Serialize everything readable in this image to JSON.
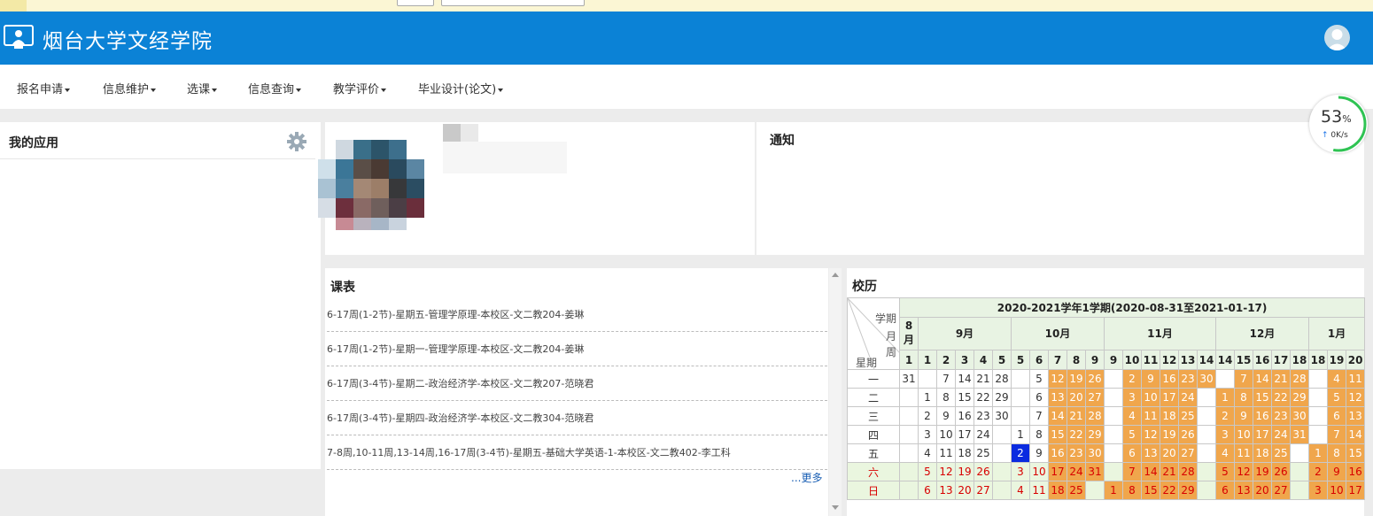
{
  "header": {
    "title": "烟台大学文经学院"
  },
  "nav": [
    "报名申请",
    "信息维护",
    "选课",
    "信息查询",
    "教学评价",
    "毕业设计(论文)"
  ],
  "apps": {
    "title": "我的应用"
  },
  "notice": {
    "title": "通知"
  },
  "schedule": {
    "title": "课表",
    "rows": [
      "6-17周(1-2节)-星期五-管理学原理-本校区-文二教204-姜琳",
      "6-17周(1-2节)-星期一-管理学原理-本校区-文二教204-姜琳",
      "6-17周(3-4节)-星期二-政治经济学-本校区-文二教207-范晓君",
      "6-17周(3-4节)-星期四-政治经济学-本校区-文二教304-范晓君",
      "7-8周,10-11周,13-14周,16-17周(3-4节)-星期五-基础大学英语-1-本校区-文二教402-李工科"
    ],
    "more": "...更多"
  },
  "calendar": {
    "title": "校历",
    "semester": "2020-2021学年1学期(2020-08-31至2021-01-17)",
    "corner": {
      "term": "学期",
      "month": "月",
      "week": "周",
      "weekday": "星期"
    },
    "months": [
      {
        "label": "8月",
        "span": 1
      },
      {
        "label": "9月",
        "span": 5
      },
      {
        "label": "10月",
        "span": 5
      },
      {
        "label": "11月",
        "span": 6
      },
      {
        "label": "12月",
        "span": 5
      },
      {
        "label": "1月",
        "span": 3
      }
    ],
    "weeks": [
      "1",
      "1",
      "2",
      "3",
      "4",
      "5",
      "5",
      "6",
      "7",
      "8",
      "9",
      "9",
      "10",
      "11",
      "12",
      "13",
      "14",
      "14",
      "15",
      "16",
      "17",
      "18",
      "18",
      "19",
      "20"
    ],
    "days": [
      {
        "name": "一",
        "cells": [
          "31",
          "",
          "7",
          "14",
          "21",
          "28",
          "",
          "5",
          "12",
          "19",
          "26",
          "",
          "2",
          "9",
          "16",
          "23",
          "30",
          "",
          "7",
          "14",
          "21",
          "28",
          "",
          "4",
          "11"
        ]
      },
      {
        "name": "二",
        "cells": [
          "",
          "1",
          "8",
          "15",
          "22",
          "29",
          "",
          "6",
          "13",
          "20",
          "27",
          "",
          "3",
          "10",
          "17",
          "24",
          "",
          "1",
          "8",
          "15",
          "22",
          "29",
          "",
          "5",
          "12"
        ]
      },
      {
        "name": "三",
        "cells": [
          "",
          "2",
          "9",
          "16",
          "23",
          "30",
          "",
          "7",
          "14",
          "21",
          "28",
          "",
          "4",
          "11",
          "18",
          "25",
          "",
          "2",
          "9",
          "16",
          "23",
          "30",
          "",
          "6",
          "13"
        ]
      },
      {
        "name": "四",
        "cells": [
          "",
          "3",
          "10",
          "17",
          "24",
          "",
          "1",
          "8",
          "15",
          "22",
          "29",
          "",
          "5",
          "12",
          "19",
          "26",
          "",
          "3",
          "10",
          "17",
          "24",
          "31",
          "",
          "7",
          "14"
        ]
      },
      {
        "name": "五",
        "cells": [
          "",
          "4",
          "11",
          "18",
          "25",
          "",
          "2",
          "9",
          "16",
          "23",
          "30",
          "",
          "6",
          "13",
          "20",
          "27",
          "",
          "4",
          "11",
          "18",
          "25",
          "",
          "1",
          "8",
          "15"
        ]
      },
      {
        "name": "六",
        "cells": [
          "",
          "5",
          "12",
          "19",
          "26",
          "",
          "3",
          "10",
          "17",
          "24",
          "31",
          "",
          "7",
          "14",
          "21",
          "28",
          "",
          "5",
          "12",
          "19",
          "26",
          "",
          "2",
          "9",
          "16"
        ]
      },
      {
        "name": "日",
        "cells": [
          "",
          "6",
          "13",
          "20",
          "27",
          "",
          "4",
          "11",
          "18",
          "25",
          "",
          "1",
          "8",
          "15",
          "22",
          "29",
          "",
          "6",
          "13",
          "20",
          "27",
          "",
          "3",
          "10",
          "17"
        ]
      }
    ],
    "today": {
      "day": 4,
      "col": 6
    }
  },
  "speed": {
    "percent": "53",
    "unit": "%",
    "rate": "0K/s"
  },
  "colors": {
    "header": "#0b82d6",
    "future": "#f0a64c",
    "weekend_text": "#d80000",
    "today": "#0a2be0"
  }
}
